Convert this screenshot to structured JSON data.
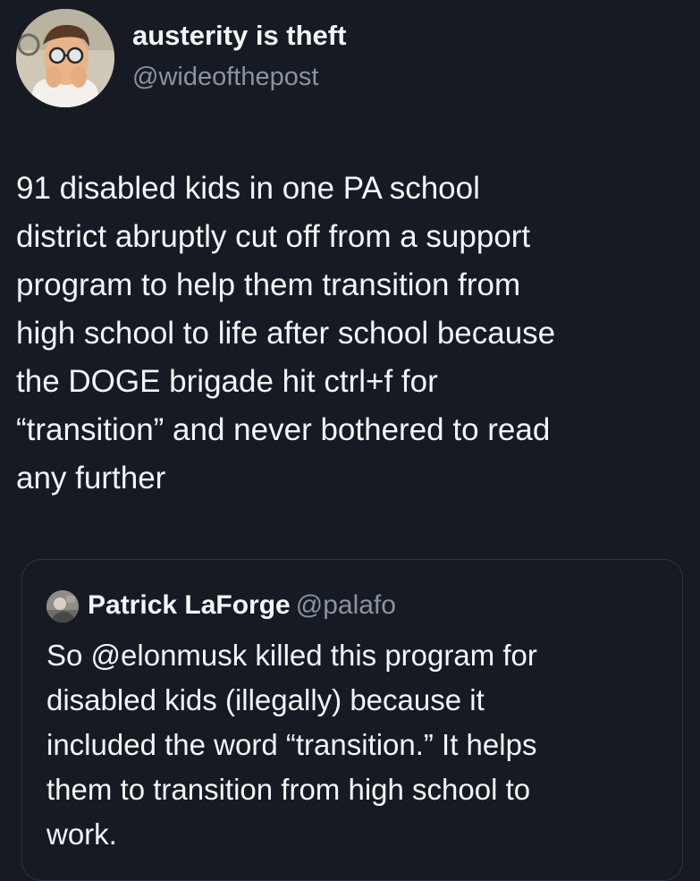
{
  "tweet": {
    "author_name": "austerity is theft",
    "author_handle": "@wideofthepost",
    "avatar_icon": "cartoon-man-glasses-avatar-icon",
    "body_lines": [
      "91 disabled kids in one PA school",
      "district abruptly cut off from a support",
      "program to help them transition from",
      "high school to life after school because",
      "the DOGE brigade hit ctrl+f for",
      "“transition” and never bothered to read",
      "any further"
    ]
  },
  "quoted_tweet": {
    "author_name": "Patrick LaForge",
    "author_handle": "@palafo",
    "avatar_icon": "profile-photo-avatar-icon",
    "body_lines": [
      "So @elonmusk killed this program for",
      "disabled kids (illegally) because it",
      "included the word “transition.” It helps",
      "them to transition from high school to",
      "work."
    ]
  },
  "colors": {
    "background": "#161b23",
    "primary_text": "#f4f5f7",
    "secondary_text": "#8b939e",
    "card_border": "#2c333d"
  }
}
